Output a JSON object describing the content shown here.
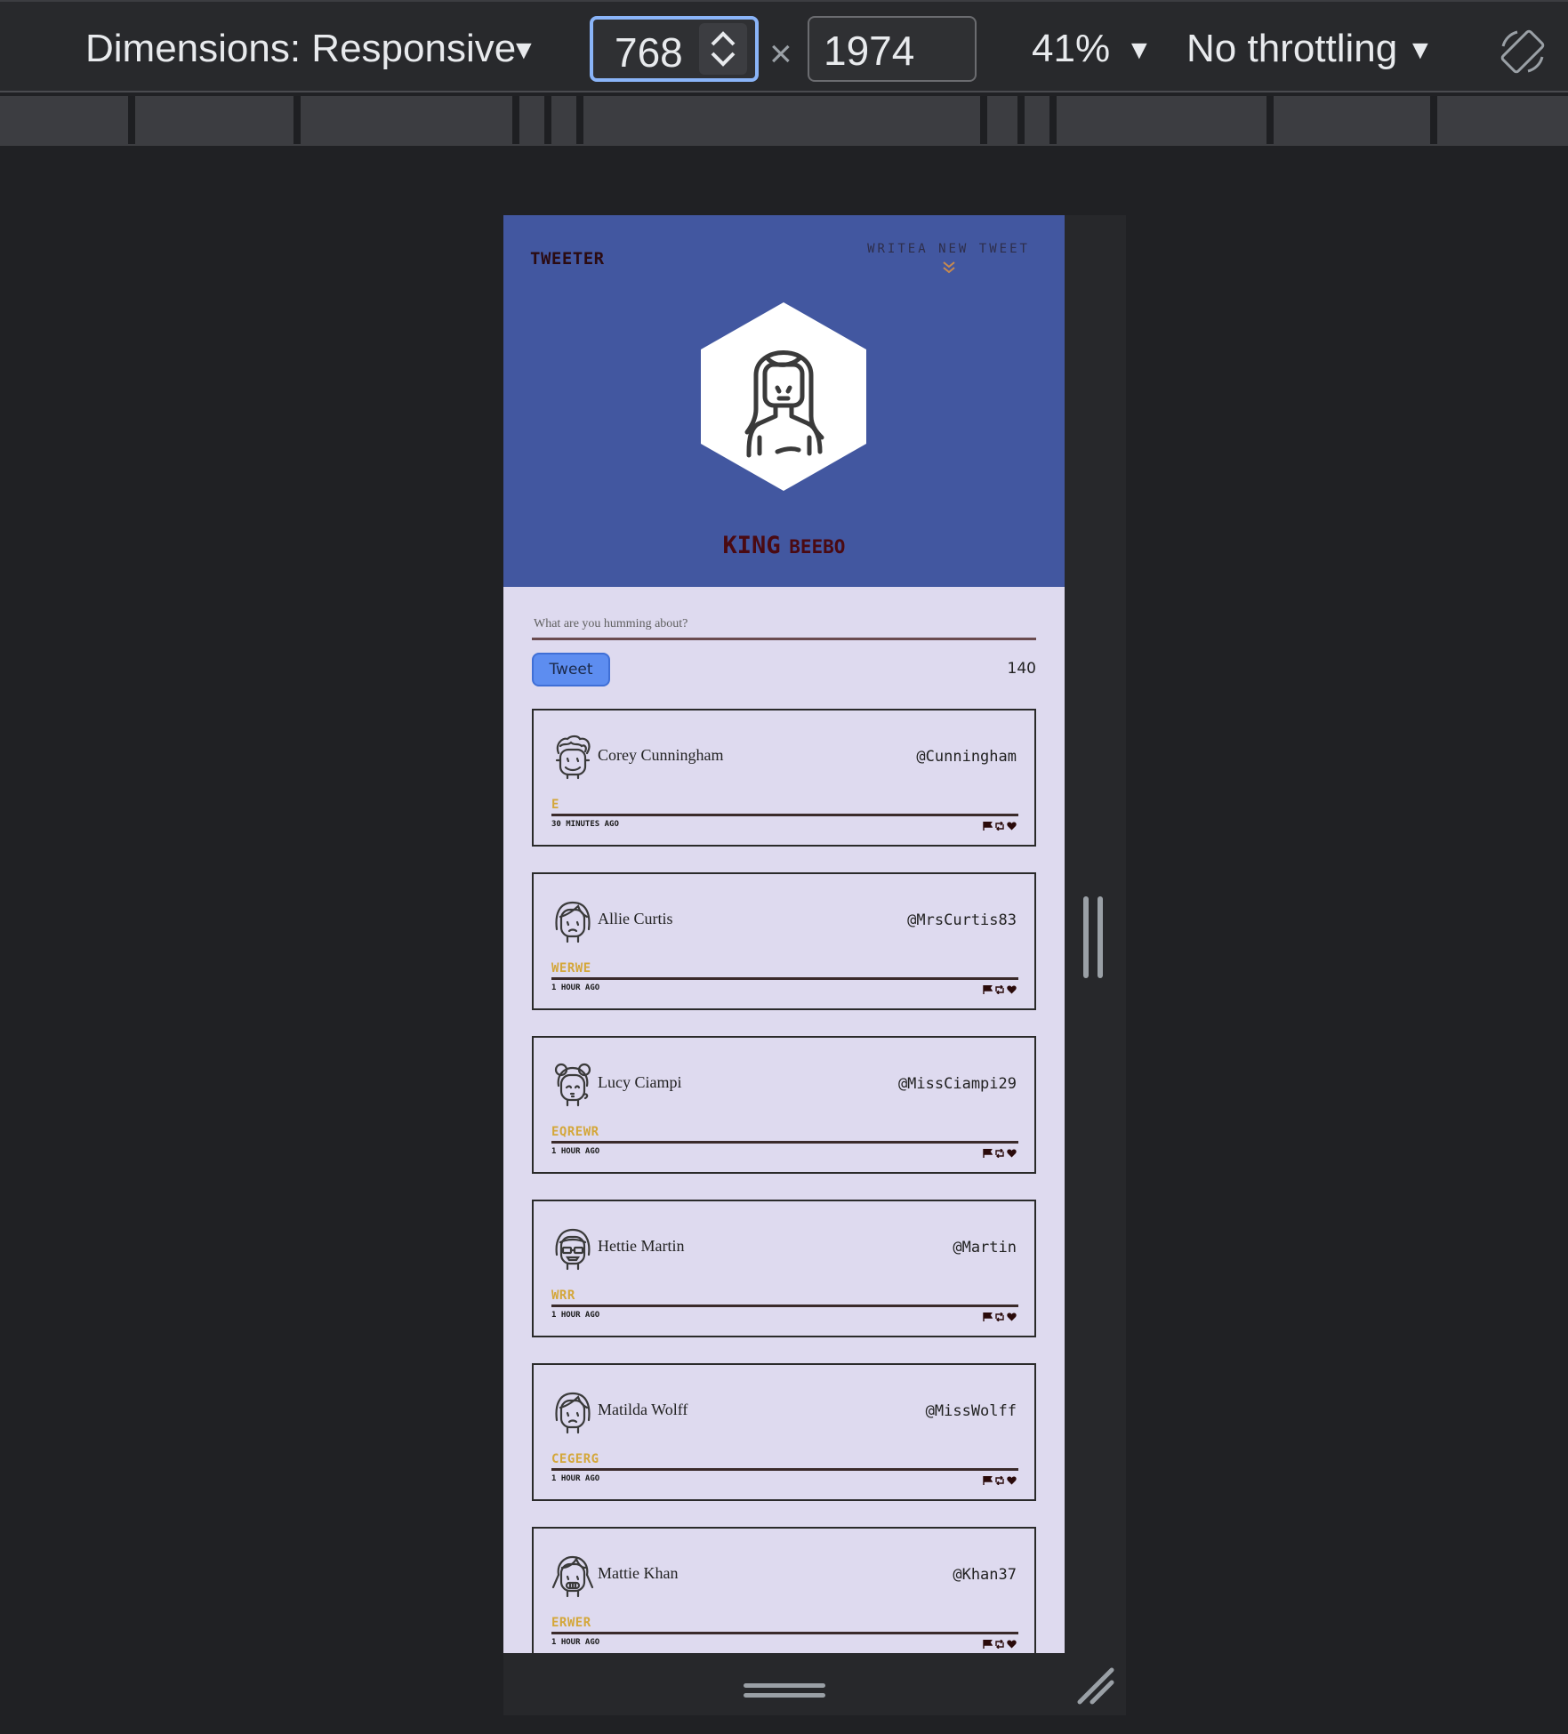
{
  "devtools": {
    "dimensions_label": "Dimensions: Responsive",
    "width_value": "768",
    "times": "×",
    "height_value": "1974",
    "zoom": "41%",
    "throttling": "No throttling"
  },
  "app": {
    "brand": "TWEETER",
    "compose_toggle": "WRITEA NEW TWEET",
    "profile": {
      "first": "KING",
      "last": "BEEBO"
    },
    "compose": {
      "placeholder": "What are you humming about?",
      "button": "Tweet",
      "counter": "140"
    }
  },
  "tweets": [
    {
      "name": "Corey Cunningham",
      "handle": "@Cunningham",
      "text": "E",
      "time": "30 MINUTES AGO",
      "avatar": "curly-hair-man-icon"
    },
    {
      "name": "Allie Curtis",
      "handle": "@MrsCurtis83",
      "text": "WERWE",
      "time": "1 HOUR AGO",
      "avatar": "woman-bob-icon"
    },
    {
      "name": "Lucy Ciampi",
      "handle": "@MissCiampi29",
      "text": "EQREWR",
      "time": "1 HOUR AGO",
      "avatar": "woman-buns-icon"
    },
    {
      "name": "Hettie Martin",
      "handle": "@Martin",
      "text": "WRR",
      "time": "1 HOUR AGO",
      "avatar": "woman-glasses-icon"
    },
    {
      "name": "Matilda Wolff",
      "handle": "@MissWolff",
      "text": "CEGERG",
      "time": "1 HOUR AGO",
      "avatar": "woman-bob-icon"
    },
    {
      "name": "Mattie Khan",
      "handle": "@Khan37",
      "text": "ERWER",
      "time": "1 HOUR AGO",
      "avatar": "woman-pigtails-icon"
    }
  ],
  "colors": {
    "header_bg": "#4257a0",
    "page_bg": "#dedaef",
    "tweet_text": "#d4a73a",
    "button": "#5d8df0"
  }
}
